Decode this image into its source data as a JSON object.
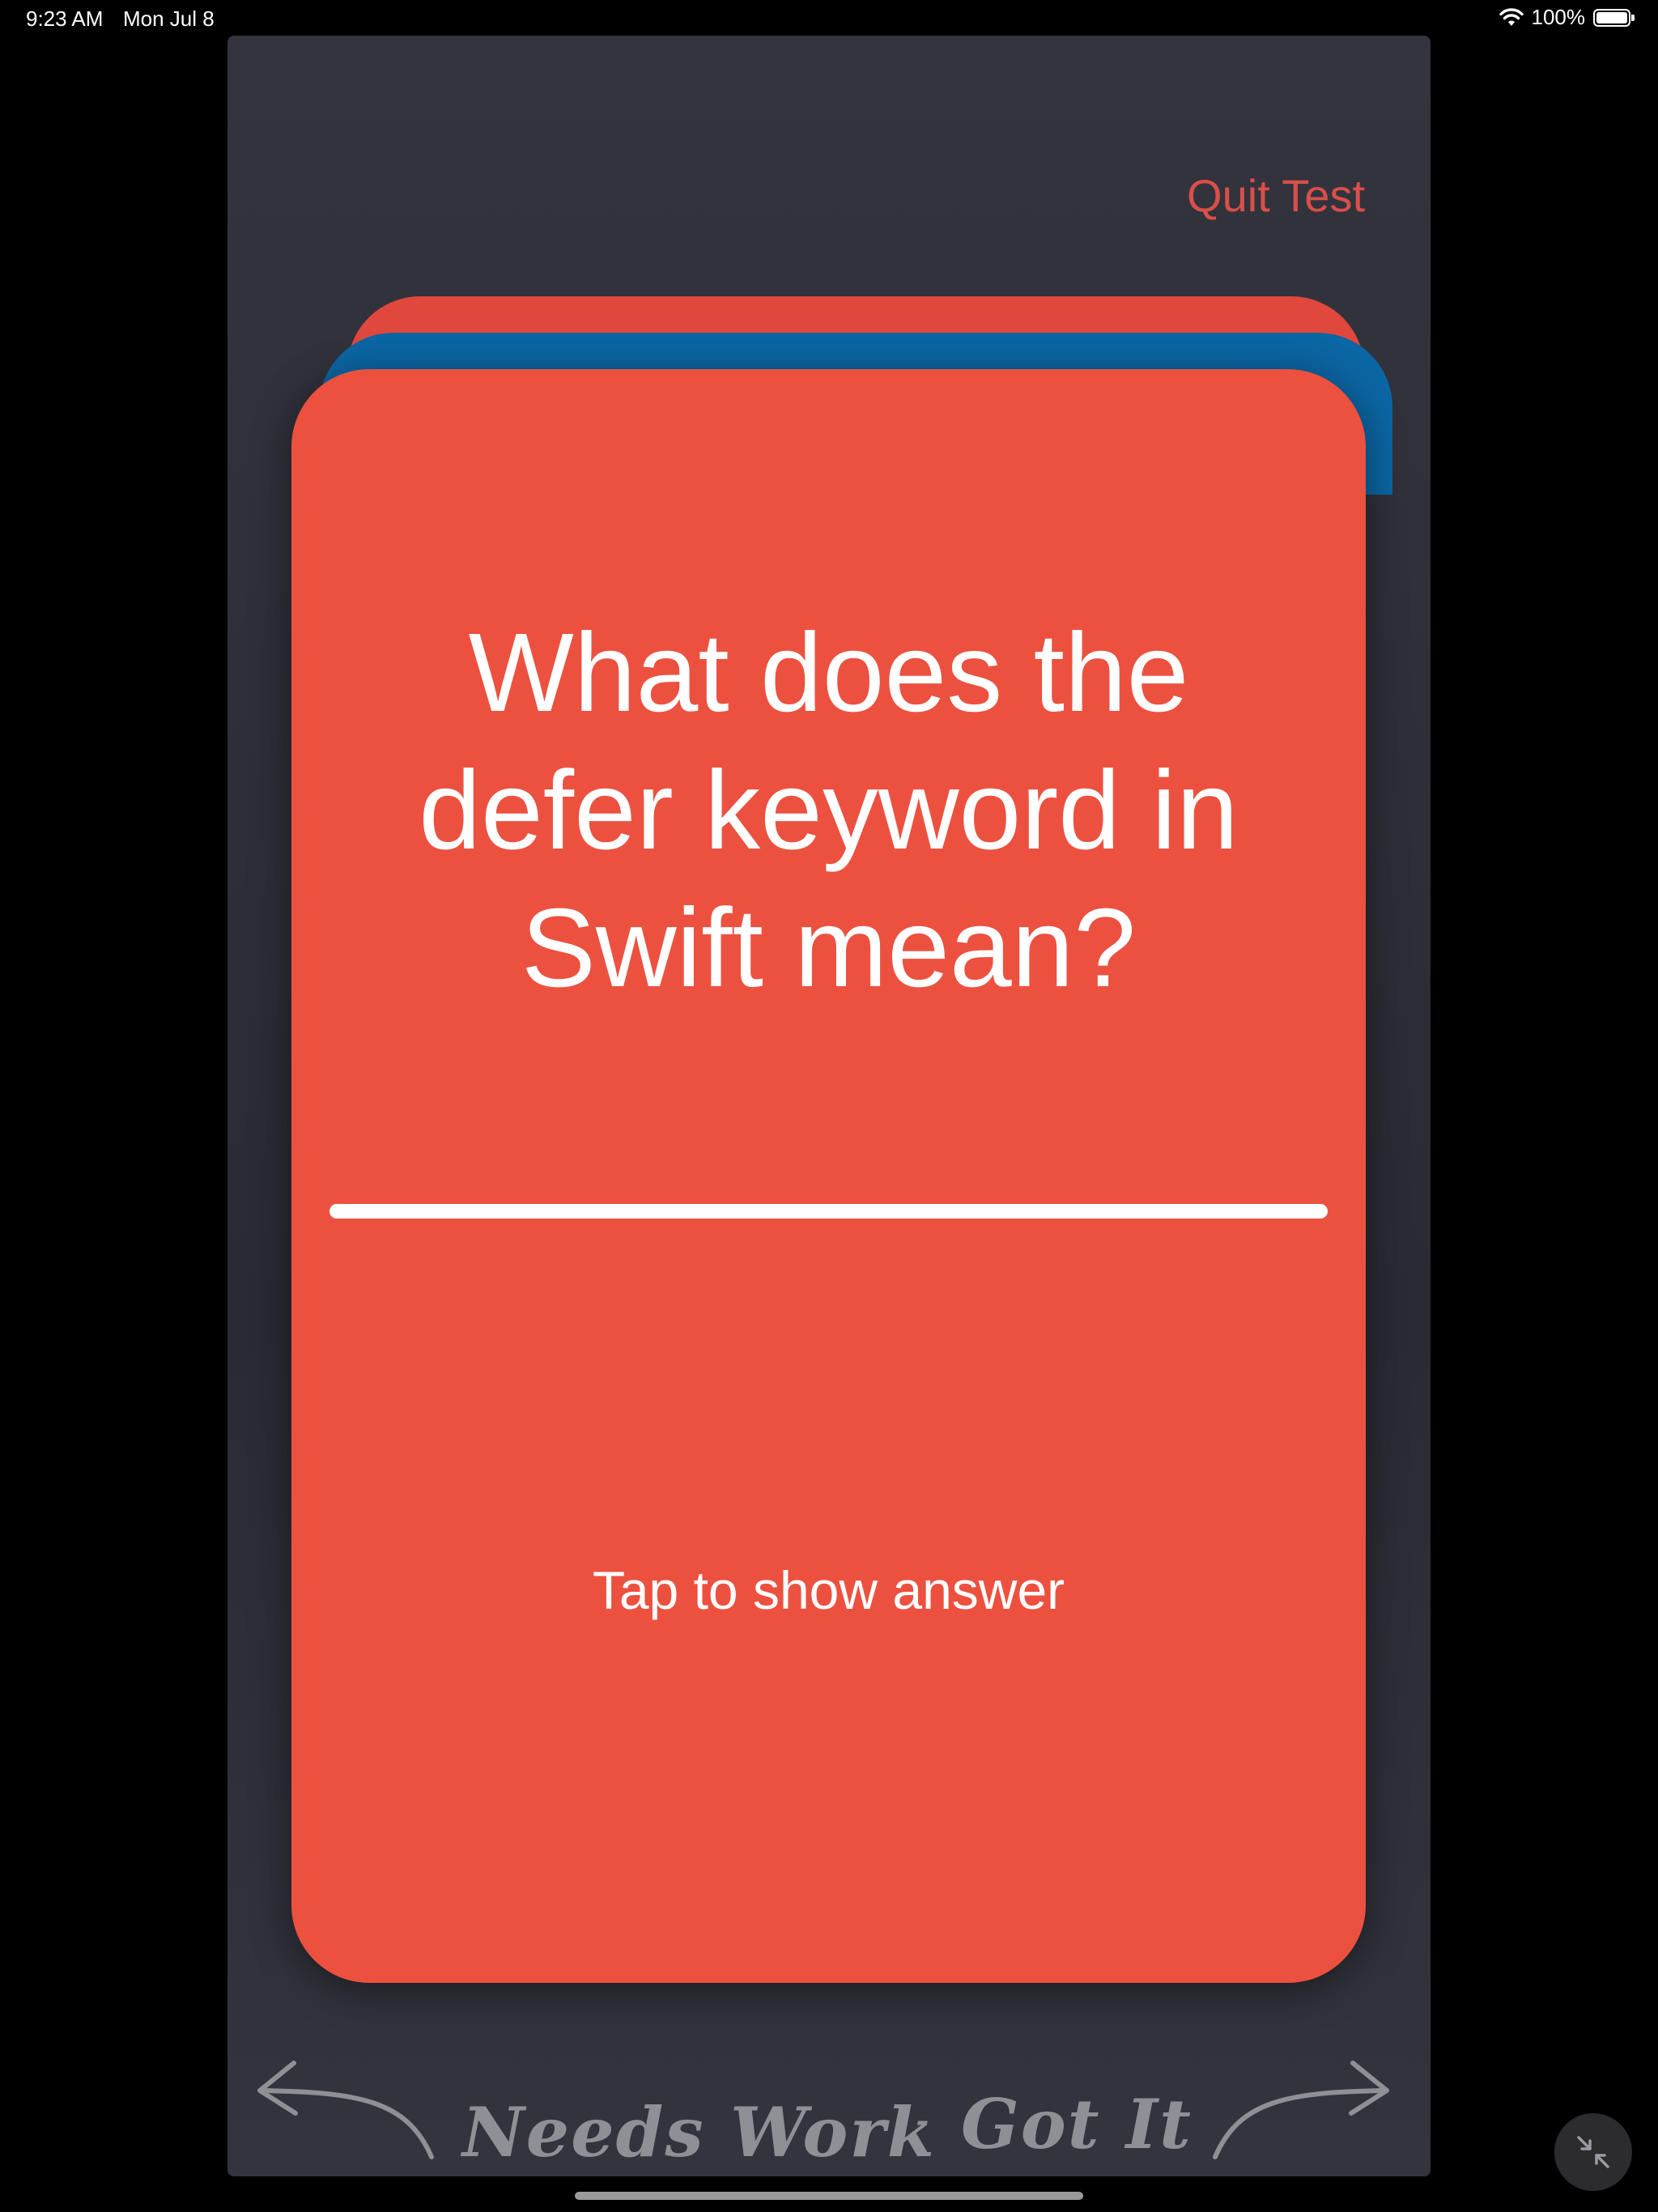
{
  "status_bar": {
    "time": "9:23 AM",
    "date": "Mon Jul 8",
    "battery": "100%",
    "wifi_icon": "wifi-icon",
    "battery_icon": "battery-icon"
  },
  "header": {
    "quit_label": "Quit Test"
  },
  "card": {
    "question": "What does the defer keyword in Swift mean?",
    "tap_hint": "Tap to show answer",
    "color": "#ec5140",
    "stack_colors": [
      "#e0483d",
      "#0b66a4"
    ]
  },
  "swipe": {
    "left_label": "Needs Work",
    "right_label": "Got It",
    "left_icon": "curved-arrow-left-icon",
    "right_icon": "curved-arrow-right-icon"
  },
  "controls": {
    "collapse_icon": "collapse-arrows-icon"
  },
  "colors": {
    "accent": "#d94f4a",
    "panel": "#2f2f38",
    "handwriting": "#8f8f96"
  }
}
